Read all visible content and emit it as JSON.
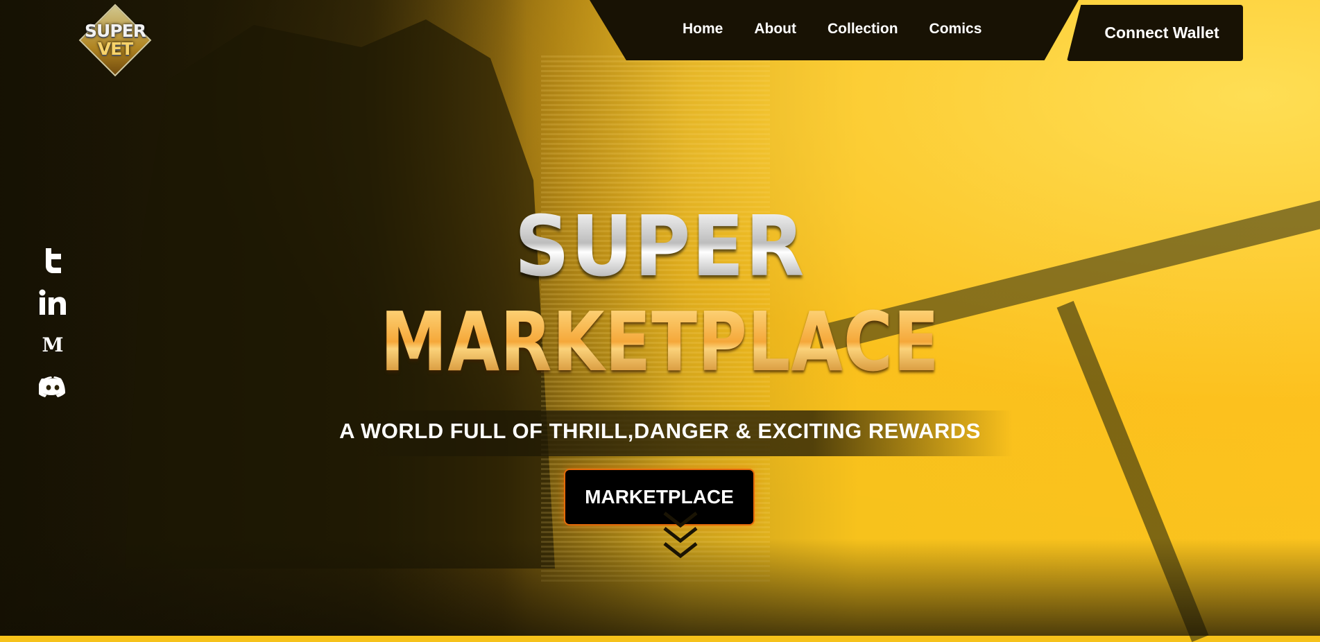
{
  "logo": {
    "line1": "SUPER",
    "line2": "VET"
  },
  "nav": {
    "items": [
      {
        "label": "Home"
      },
      {
        "label": "About"
      },
      {
        "label": "Collection"
      },
      {
        "label": "Comics"
      }
    ],
    "wallet_label": "Connect Wallet"
  },
  "social": [
    "twitter-icon",
    "linkedin-icon",
    "medium-icon",
    "discord-icon"
  ],
  "hero": {
    "title_line1": "SUPER",
    "title_line2": "MARKETPLACE",
    "tagline": "A WORLD FULL OF THRILL,DANGER & EXCITING REWARDS",
    "cta_label": "MARKETPLACE"
  },
  "colors": {
    "accent": "#f6c21a",
    "dark": "#181204",
    "cta_glow": "#e56a0a"
  }
}
